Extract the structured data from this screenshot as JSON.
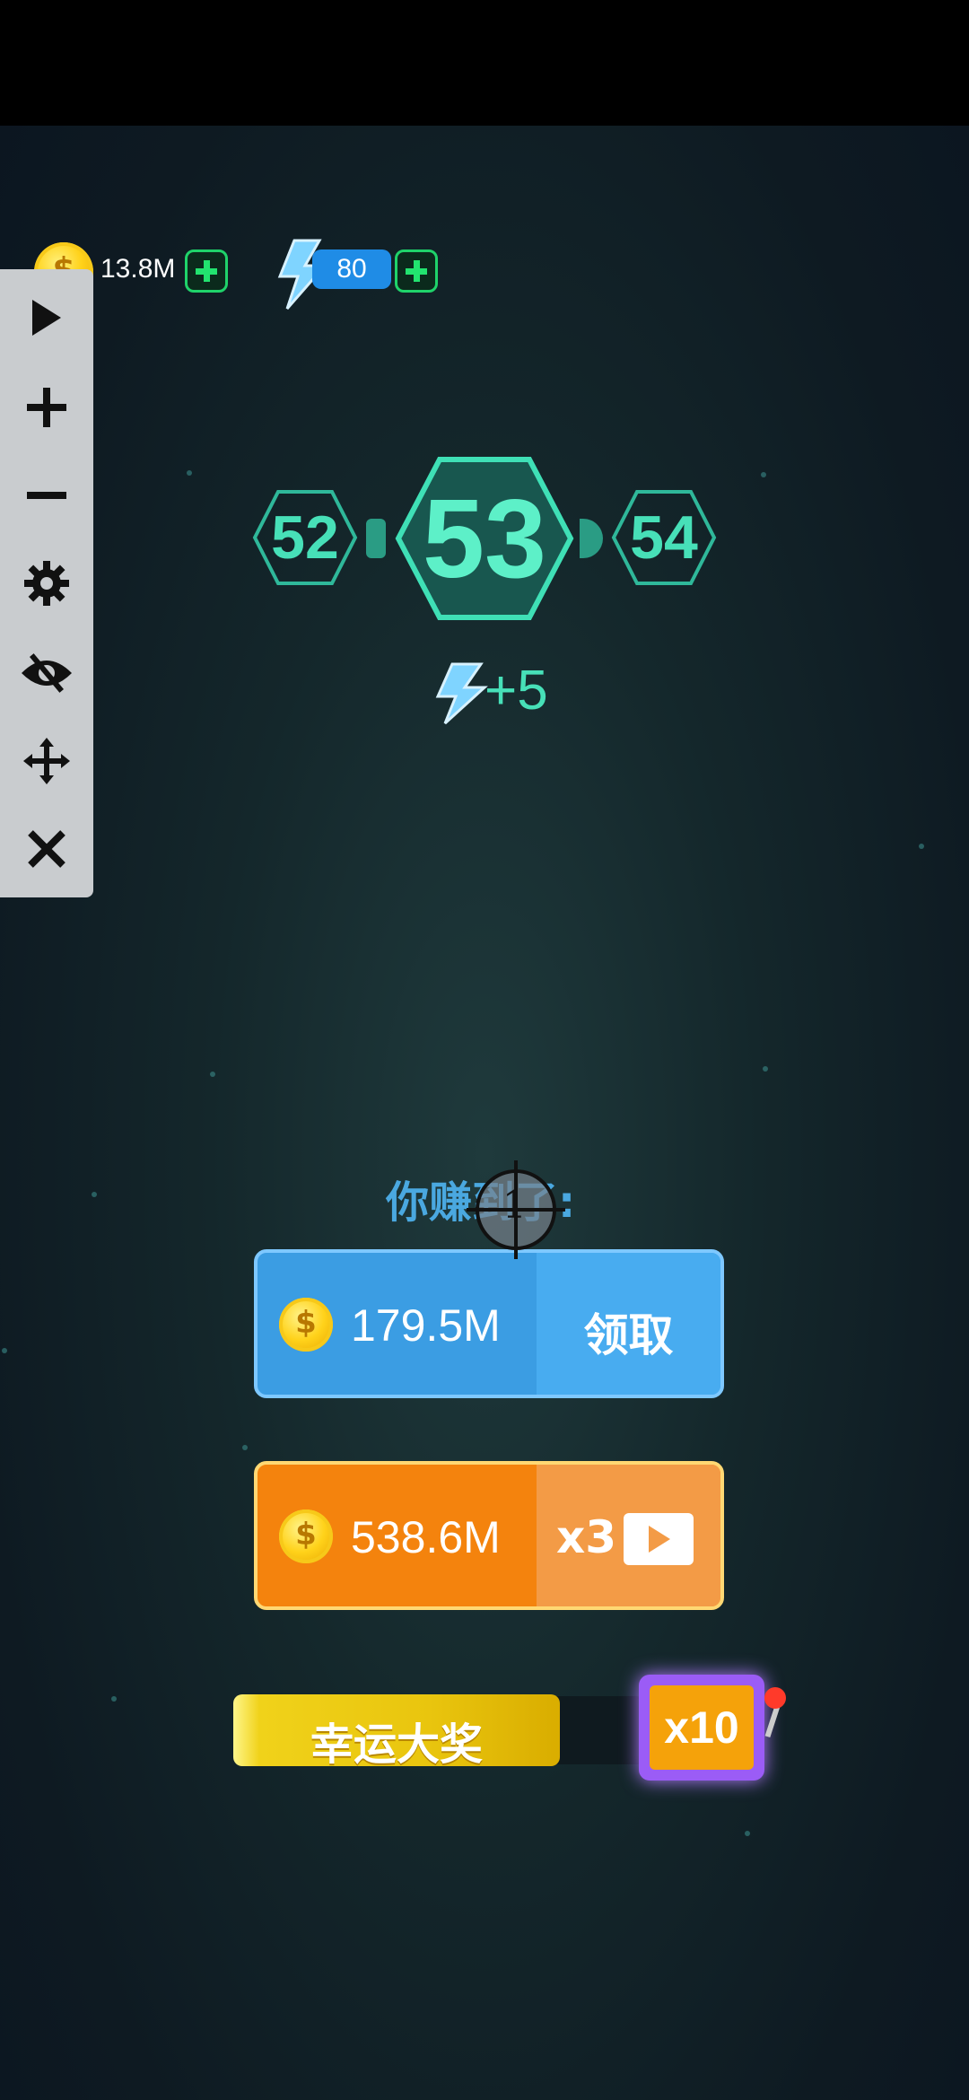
{
  "header": {
    "coins": "13.8M",
    "energy": "80"
  },
  "tools": [
    {
      "name": "play-icon",
      "glyph": "▶"
    },
    {
      "name": "zoom-in-icon",
      "glyph": "+"
    },
    {
      "name": "zoom-out-icon",
      "glyph": "−"
    },
    {
      "name": "gear-icon",
      "glyph": "⚙"
    },
    {
      "name": "eye-off-icon",
      "glyph": "👁"
    },
    {
      "name": "move-icon",
      "glyph": "✥"
    },
    {
      "name": "close-icon",
      "glyph": "✕"
    }
  ],
  "levels": {
    "previous": "52",
    "current": "53",
    "next": "54",
    "energy_reward": "+5"
  },
  "earn": {
    "label": "你赚到了:",
    "claim_amount": "179.5M",
    "claim_label": "领取",
    "video_amount": "538.6M",
    "video_multiplier": "x3"
  },
  "lucky": {
    "label": "幸运大奖",
    "multiplier": "x10"
  },
  "cursor": {
    "number": "1"
  },
  "colors": {
    "accent_teal": "#47e0b8",
    "claim_blue": "#3b9de3",
    "video_orange": "#f4830d"
  }
}
